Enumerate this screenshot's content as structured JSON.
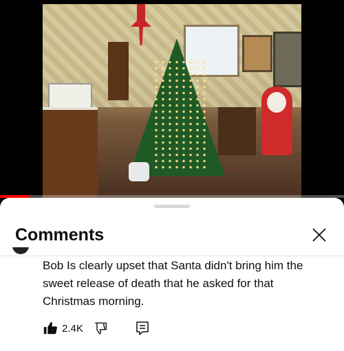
{
  "video": {
    "progress_fraction": 0.085,
    "progress_color": "#ff0000"
  },
  "comments_panel": {
    "title": "Comments",
    "close_icon": "close-icon"
  },
  "comment": {
    "text": "Bob Is clearly upset that Santa didn't bring him the sweet release of death that he asked for that Christmas morning.",
    "like_count": "2.4K",
    "icons": [
      "thumb-up-icon",
      "thumb-down-icon",
      "reply-icon"
    ]
  }
}
